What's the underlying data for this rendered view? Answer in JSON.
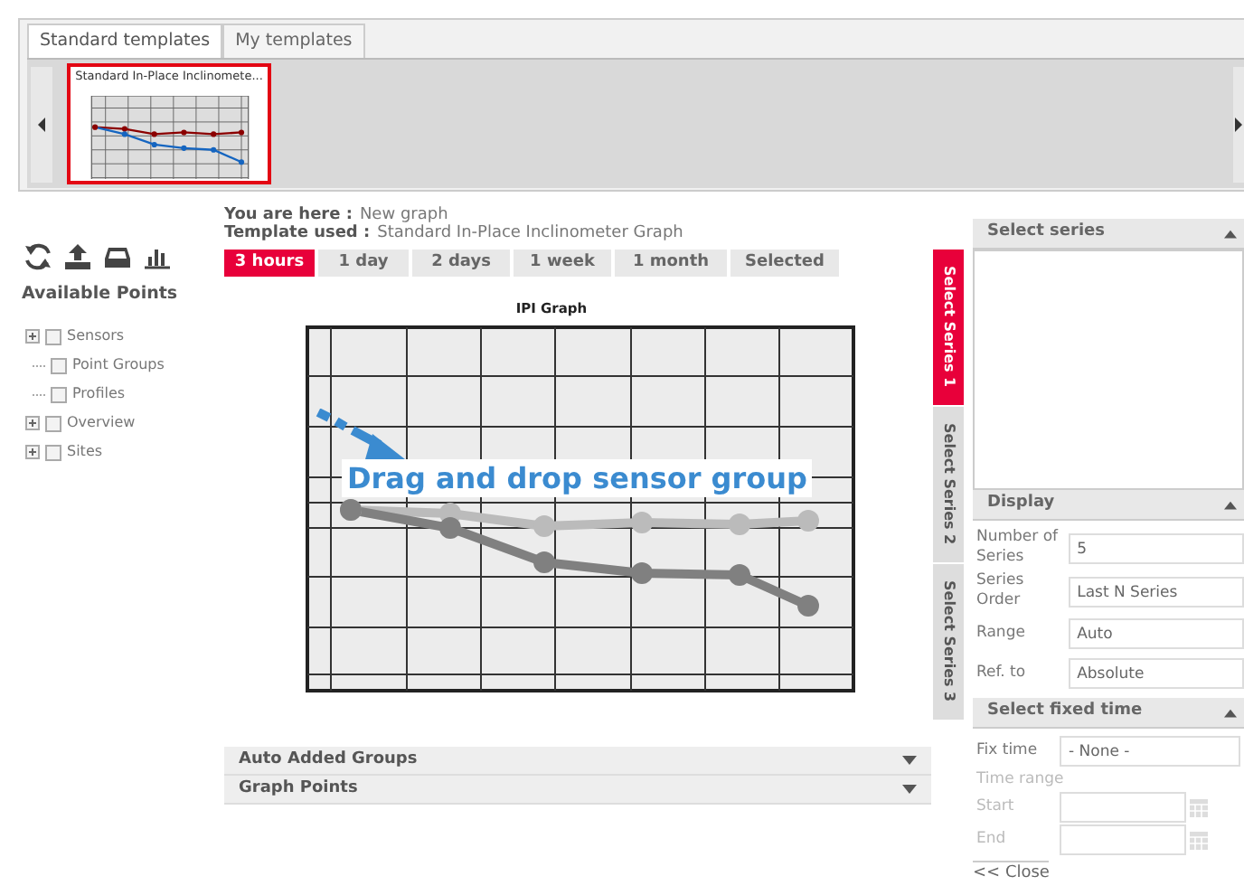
{
  "template_tabs": [
    {
      "label": "Standard templates",
      "selected": true
    },
    {
      "label": "My templates",
      "selected": false
    }
  ],
  "templates": [
    {
      "title": "Standard In-Place Inclinomete...",
      "selected": true
    }
  ],
  "breadcrumb": [
    {
      "label": "You are here :",
      "value": "New graph"
    },
    {
      "label": "Template used :",
      "value": "Standard In-Place Inclinometer Graph"
    }
  ],
  "range_tabs": [
    {
      "label": "3 hours",
      "selected": true
    },
    {
      "label": "1 day",
      "selected": false
    },
    {
      "label": "2 days",
      "selected": false
    },
    {
      "label": "1 week",
      "selected": false
    },
    {
      "label": "1 month",
      "selected": false
    },
    {
      "label": "Selected",
      "selected": false
    }
  ],
  "sidebar": {
    "title": "Available Points",
    "tree": [
      {
        "label": "Sensors",
        "kind": "folder",
        "checked": false
      },
      {
        "label": "Point Groups",
        "kind": "leaf",
        "checked": false
      },
      {
        "label": "Profiles",
        "kind": "leaf",
        "checked": false
      },
      {
        "label": "Overview",
        "kind": "folder",
        "checked": false
      },
      {
        "label": "Sites",
        "kind": "folder",
        "checked": false
      }
    ]
  },
  "graph": {
    "title": "IPI Graph",
    "hint": "Drag and drop sensor group"
  },
  "sections": [
    {
      "title": "Auto Added Groups",
      "expanded": false
    },
    {
      "title": "Graph Points",
      "expanded": false
    }
  ],
  "series_tabs": [
    {
      "label": "Select Series 1",
      "selected": true
    },
    {
      "label": "Select Series 2",
      "selected": false
    },
    {
      "label": "Select Series 3",
      "selected": false
    }
  ],
  "select_series": {
    "title": "Select series",
    "expanded": true
  },
  "display": {
    "title": "Display",
    "expanded": true,
    "fields": [
      {
        "label": "Number of Series",
        "value": "5"
      },
      {
        "label": "Series Order",
        "value": "Last N Series"
      },
      {
        "label": "Range",
        "value": "Auto"
      },
      {
        "label": "Ref. to",
        "value": "Absolute"
      }
    ]
  },
  "fixed_time": {
    "title": "Select fixed time",
    "expanded": true,
    "fields": [
      {
        "label": "Fix time",
        "kind": "select",
        "value": "- None -",
        "disabled": false
      },
      {
        "label": "Time range",
        "kind": "caption",
        "disabled": true
      },
      {
        "label": "Start",
        "kind": "date",
        "disabled": true
      },
      {
        "label": "End",
        "kind": "date",
        "disabled": true
      }
    ]
  },
  "close_link": "<< Close"
}
